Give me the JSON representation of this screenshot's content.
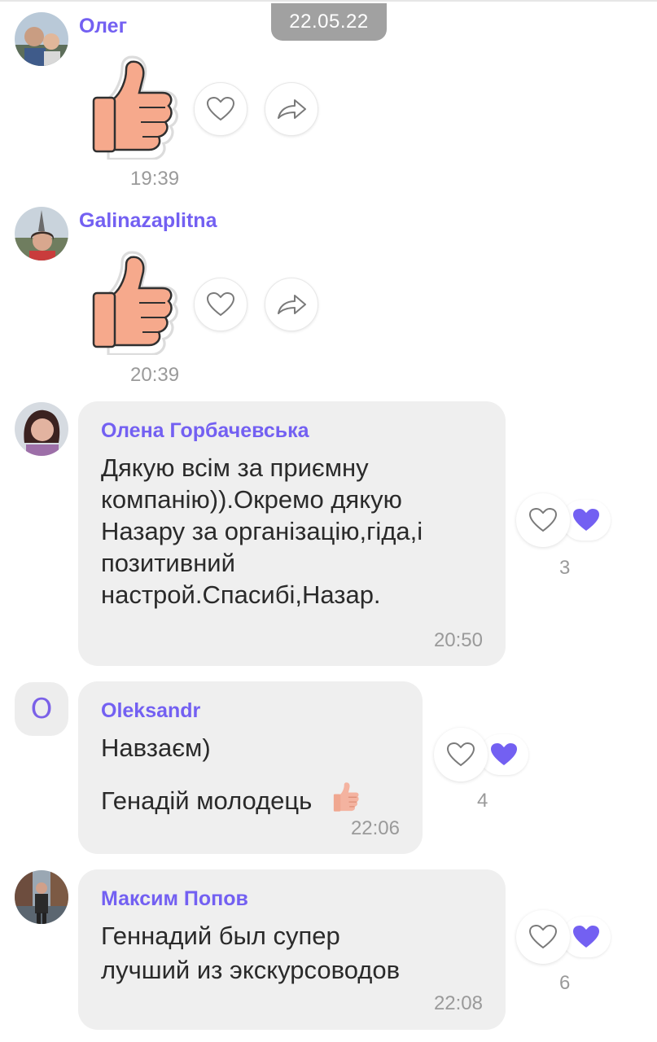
{
  "date_chip": "22.05.22",
  "messages": [
    {
      "sender": "Олег",
      "time": "19:39"
    },
    {
      "sender": "Galinazaplitna",
      "time": "20:39"
    },
    {
      "sender": "Олена Горбачевська",
      "lines": [
        "Дякую всім за приємну",
        "компанію)).Окремо дякую",
        "Назару за організацію,гіда,і",
        "позитивний",
        "настрой.Спасибі,Назар."
      ],
      "time": "20:50",
      "likes": "3"
    },
    {
      "sender": "Oleksandr",
      "avatar_letter": "O",
      "lines": [
        "Навзаєм)",
        "Генадій молодець"
      ],
      "time": "22:06",
      "likes": "4"
    },
    {
      "sender": "Максим Попов",
      "lines": [
        "Геннадий был супер",
        "лучший  из экскурсоводов"
      ],
      "time": "22:08",
      "likes": "6"
    }
  ],
  "colors": {
    "accent": "#7360f2",
    "bubble": "#efefef",
    "timestamp": "#9a9a9a"
  },
  "icons": [
    "thumbs-up-sticker",
    "heart-outline-icon",
    "share-arrow-icon",
    "heart-filled-icon"
  ]
}
